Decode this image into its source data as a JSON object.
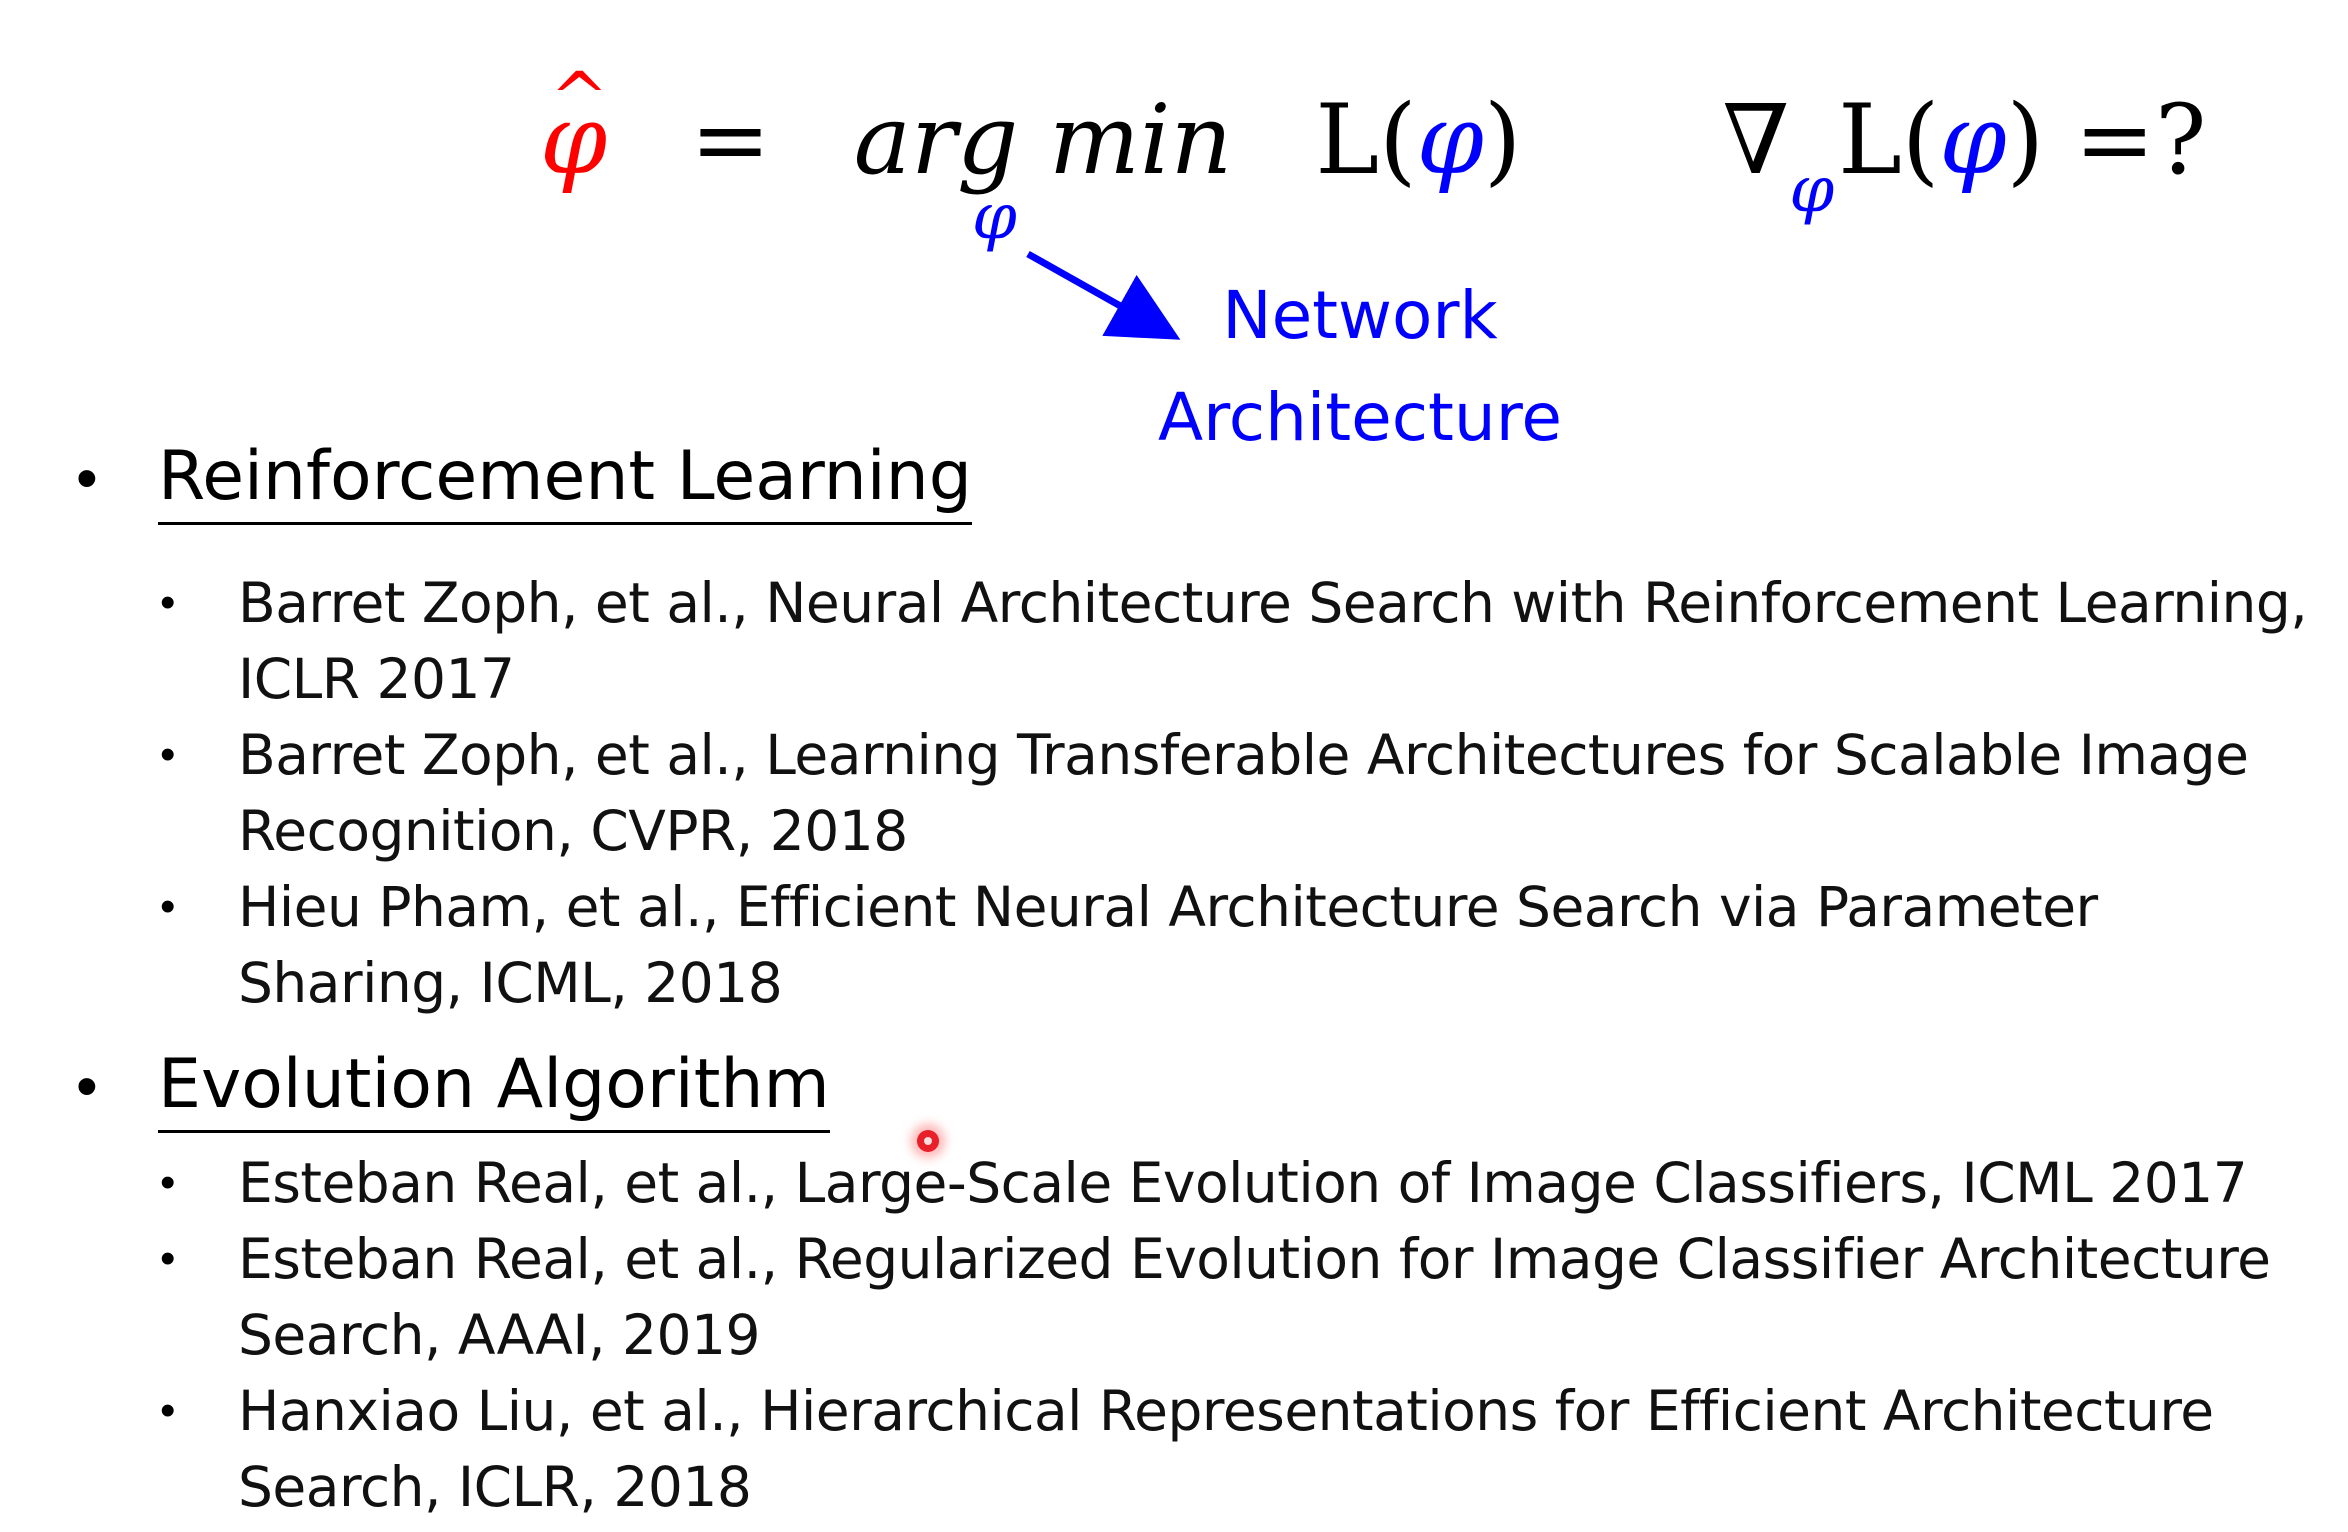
{
  "formula": {
    "phi_hat": "φ",
    "hat": "^",
    "equals": "=",
    "argmin": "arg min",
    "loss": "L(",
    "phi": "φ",
    "close": ")",
    "argmin_subscript": "φ",
    "nabla": "∇",
    "grad_sub": "φ",
    "grad_loss": "L(",
    "grad_phi": "φ",
    "grad_close": ")",
    "grad_question": "=?"
  },
  "annotation": {
    "line1": "Network",
    "line2": "Architecture"
  },
  "colors": {
    "highlight_red": "#ff0000",
    "annotation_blue": "#0000ff",
    "laser_pointer": "#e8202a"
  },
  "sections": [
    {
      "bullet": "•",
      "heading": "Reinforcement Learning",
      "refs": [
        {
          "bullet": "•",
          "text": "Barret Zoph, et al., Neural Architecture Search with Reinforcement Learning, ICLR 2017"
        },
        {
          "bullet": "•",
          "text": "Barret Zoph, et al., Learning Transferable Architectures for Scalable Image Recognition, CVPR, 2018"
        },
        {
          "bullet": "•",
          "text": "Hieu Pham, et al., Efficient Neural Architecture Search via Parameter Sharing, ICML, 2018"
        }
      ]
    },
    {
      "bullet": "•",
      "heading": "Evolution Algorithm",
      "refs": [
        {
          "bullet": "•",
          "text": "Esteban Real, et al., Large-Scale Evolution of Image Classifiers, ICML 2017"
        },
        {
          "bullet": "•",
          "text": "Esteban Real, et al., Regularized Evolution for Image Classifier Architecture Search, AAAI, 2019"
        },
        {
          "bullet": "•",
          "text": "Hanxiao Liu, et al., Hierarchical Representations for Efficient Architecture Search, ICLR, 2018"
        }
      ]
    }
  ]
}
